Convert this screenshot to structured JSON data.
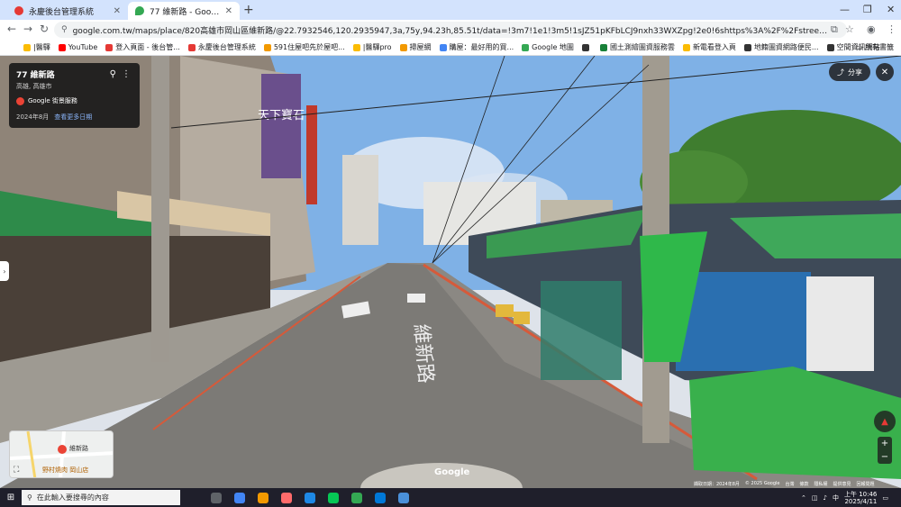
{
  "browser": {
    "tabs": [
      {
        "title": "永慶後台管理系統",
        "active": false,
        "favicon_color": "#e53935"
      },
      {
        "title": "77 維新路 - Google 地圖",
        "active": true,
        "favicon_color": "#34a853"
      }
    ],
    "url": "google.com.tw/maps/place/820高雄市岡山區維新路/@22.7932546,120.2935947,3a,75y,94.23h,85.51t/data=!3m7!1e1!3m5!1sJZ51pKFbLCJ9nxh33WXZpg!2e0!6shttps%3A%2F%2Fstreetviewpixels-pa.googleapis.com%2Fv1%2Fthumbnail%3Fcb_clie...",
    "bookmarks": [
      {
        "label": "|醫驛",
        "color": "#fbbc04"
      },
      {
        "label": "YouTube",
        "color": "#ff0000"
      },
      {
        "label": "登入頁面 - 後台管...",
        "color": "#e53935"
      },
      {
        "label": "永慶後台管理系統",
        "color": "#e53935"
      },
      {
        "label": "591住屋吧先於屋吧...",
        "color": "#f29900"
      },
      {
        "label": "|醫驛pro",
        "color": "#fbbc04"
      },
      {
        "label": "掃屋網",
        "color": "#f29900"
      },
      {
        "label": "購屋：最好用的買...",
        "color": "#4285f4"
      },
      {
        "label": "Google 地圖",
        "color": "#34a853"
      },
      {
        "label": "",
        "color": "#333333"
      },
      {
        "label": "國土測繪圖資服務雲",
        "color": "#188038"
      },
      {
        "label": "新電看登入頁",
        "color": "#fbbc04"
      },
      {
        "label": "地籍圖資網路便民...",
        "color": "#333333"
      },
      {
        "label": "空間資訊網站",
        "color": "#333333"
      }
    ],
    "all_bookmarks_label": "所有書籤"
  },
  "streetview": {
    "info": {
      "address": "77 維新路",
      "region": "高雄, 高雄市",
      "source": "Google 街景服務",
      "date": "2024年8月",
      "more_dates": "查看更多日期"
    },
    "share_label": "分享",
    "minimap": {
      "place": "維新路",
      "poi": "野村燒肉 岡山店"
    },
    "watermark": "Google",
    "footer": [
      "擷取日期：2024年8月",
      "© 2025 Google",
      "台灣",
      "條款",
      "隱私權",
      "提供意見",
      "回報問題"
    ],
    "shop_sign": "天下寶石",
    "road_text": "維新路"
  },
  "taskbar": {
    "search_placeholder": "在此輸入要搜尋的內容",
    "time": "上午 10:46",
    "date": "2025/4/11",
    "icons": [
      "#5f6368",
      "#4285f4",
      "#f29900",
      "#ff6b6b",
      "#1e88e5",
      "#06c755",
      "#34a853",
      "#0078d7",
      "#4a90d9"
    ]
  }
}
